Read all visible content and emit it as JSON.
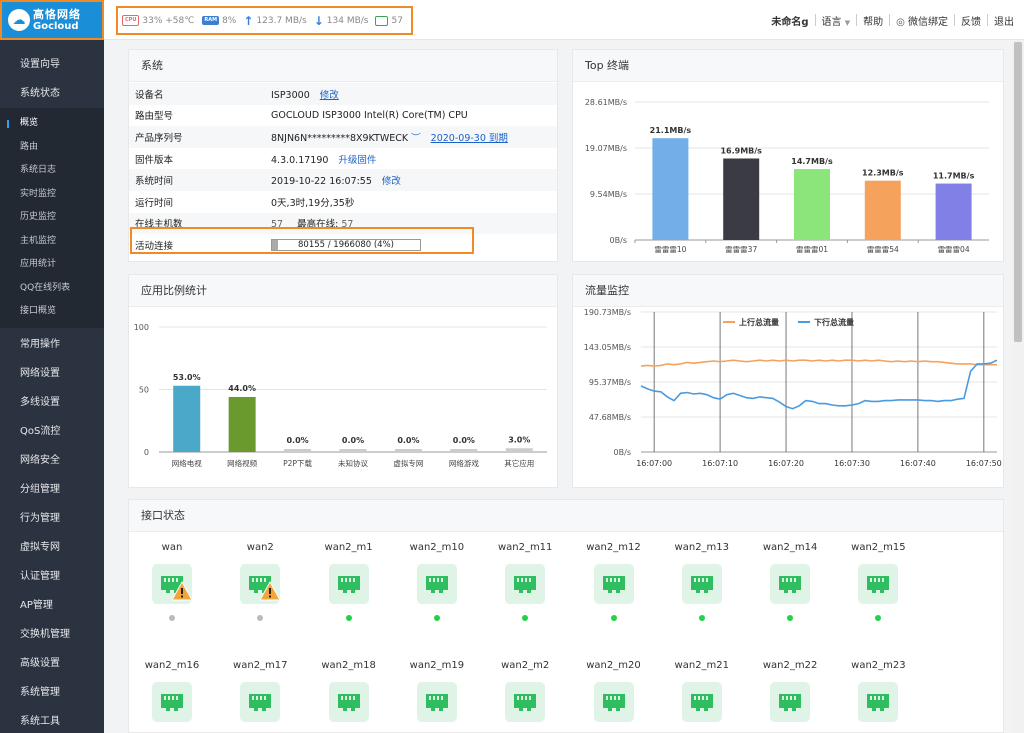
{
  "brand": {
    "name_cn": "高恪网络",
    "name_en": "Gocloud"
  },
  "status": {
    "cpu_icon": "CPU",
    "cpu": "33% +58℃",
    "ram_icon": "RAM",
    "ram": "8%",
    "up": "123.7 MB/s",
    "down": "134 MB/s",
    "hosts": "57"
  },
  "topnav": {
    "user": "未命名g",
    "lang": "语言",
    "help": "帮助",
    "wechat": "微信绑定",
    "feedback": "反馈",
    "logout": "退出"
  },
  "sidebar": {
    "main_before": [
      {
        "label": "设置向导"
      },
      {
        "label": "系统状态"
      }
    ],
    "sub": [
      {
        "label": "概览",
        "active": true
      },
      {
        "label": "路由"
      },
      {
        "label": "系统日志"
      },
      {
        "label": "实时监控"
      },
      {
        "label": "历史监控"
      },
      {
        "label": "主机监控"
      },
      {
        "label": "应用统计"
      },
      {
        "label": "QQ在线列表"
      },
      {
        "label": "接口概览"
      }
    ],
    "main_after": [
      {
        "label": "常用操作"
      },
      {
        "label": "网络设置"
      },
      {
        "label": "多线设置"
      },
      {
        "label": "QoS流控"
      },
      {
        "label": "网络安全"
      },
      {
        "label": "分组管理"
      },
      {
        "label": "行为管理"
      },
      {
        "label": "虚拟专网"
      },
      {
        "label": "认证管理"
      },
      {
        "label": "AP管理"
      },
      {
        "label": "交换机管理"
      },
      {
        "label": "高级设置"
      },
      {
        "label": "系统管理"
      },
      {
        "label": "系统工具"
      }
    ]
  },
  "system": {
    "title": "系统",
    "device_name": {
      "label": "设备名",
      "value": "ISP3000",
      "link": "修改"
    },
    "model": {
      "label": "路由型号",
      "value": "GOCLOUD ISP3000 Intel(R) Core(TM) CPU"
    },
    "serial": {
      "label": "产品序列号",
      "value": "8NJN6N*********8X9KTWECK",
      "link": "2020-09-30 到期"
    },
    "firmware": {
      "label": "固件版本",
      "value": "4.3.0.17190",
      "link": "升级固件"
    },
    "systime": {
      "label": "系统时间",
      "value": "2019-10-22 16:07:55",
      "link": "修改"
    },
    "uptime": {
      "label": "运行时间",
      "value": "0天,3时,19分,35秒"
    },
    "online": {
      "label": "在线主机数",
      "value": "57",
      "max_label": "最高在线:",
      "max_value": "57"
    },
    "conn": {
      "label": "活动连接",
      "text": "80155 / 1966080 (4%)",
      "percent": 4
    }
  },
  "top_terminals": {
    "title": "Top 终端",
    "chart_data": {
      "type": "bar",
      "categories": [
        "雷雷雷10",
        "雷雷雷37",
        "雷雷雷01",
        "雷雷雷54",
        "雷雷雷04"
      ],
      "values": [
        21.1,
        16.9,
        14.7,
        12.3,
        11.7
      ],
      "value_labels": [
        "21.1MB/s",
        "16.9MB/s",
        "14.7MB/s",
        "12.3MB/s",
        "11.7MB/s"
      ],
      "colors": [
        "#73aee8",
        "#3b3c43",
        "#8ce57a",
        "#f5a35c",
        "#8080e6"
      ],
      "ylim": [
        0,
        28.61
      ],
      "yticks": [
        0,
        9.54,
        19.07,
        28.61
      ],
      "ytick_labels": [
        "0B/s",
        "9.54MB/s",
        "19.07MB/s",
        "28.61MB/s"
      ],
      "grid": true
    }
  },
  "app_stats": {
    "title": "应用比例统计",
    "chart_data": {
      "type": "bar",
      "categories": [
        "网络电视",
        "网络视频",
        "P2P下载",
        "未知协议",
        "虚拟专网",
        "网络游戏",
        "其它应用"
      ],
      "values": [
        53.0,
        44.0,
        0.0,
        0.0,
        0.0,
        0.0,
        3.0
      ],
      "value_labels": [
        "53.0%",
        "44.0%",
        "0.0%",
        "0.0%",
        "0.0%",
        "0.0%",
        "3.0%"
      ],
      "colors": [
        "#4aa8c8",
        "#6a9a2e",
        "#cccccc",
        "#cccccc",
        "#cccccc",
        "#cccccc",
        "#cccccc"
      ],
      "ylim": [
        0,
        100
      ],
      "yticks": [
        0,
        50,
        100
      ],
      "ytick_labels": [
        "0",
        "50",
        "100"
      ],
      "grid": true
    }
  },
  "flow": {
    "title": "流量监控",
    "chart_data": {
      "type": "line",
      "x": [
        "16:06:58",
        "16:06:59",
        "16:07:00",
        "16:07:01",
        "16:07:02",
        "16:07:03",
        "16:07:04",
        "16:07:05",
        "16:07:06",
        "16:07:07",
        "16:07:08",
        "16:07:09",
        "16:07:10",
        "16:07:11",
        "16:07:12",
        "16:07:13",
        "16:07:14",
        "16:07:15",
        "16:07:16",
        "16:07:17",
        "16:07:18",
        "16:07:19",
        "16:07:20",
        "16:07:21",
        "16:07:22",
        "16:07:23",
        "16:07:24",
        "16:07:25",
        "16:07:26",
        "16:07:27",
        "16:07:28",
        "16:07:29",
        "16:07:30",
        "16:07:31",
        "16:07:32",
        "16:07:33",
        "16:07:34",
        "16:07:35",
        "16:07:36",
        "16:07:37",
        "16:07:38",
        "16:07:39",
        "16:07:40",
        "16:07:41",
        "16:07:42",
        "16:07:43",
        "16:07:44",
        "16:07:45",
        "16:07:46",
        "16:07:47",
        "16:07:48",
        "16:07:49",
        "16:07:50",
        "16:07:51",
        "16:07:52"
      ],
      "series": [
        {
          "name": "上行总流量",
          "color": "#f5a35c",
          "values": [
            117,
            118,
            117,
            118,
            120,
            119,
            120,
            122,
            121,
            122,
            123,
            124,
            123,
            124,
            125,
            124,
            123,
            124,
            125,
            124,
            125,
            124,
            125,
            124,
            125,
            125,
            124,
            125,
            124,
            125,
            124,
            125,
            125,
            124,
            125,
            124,
            125,
            124,
            123,
            124,
            123,
            124,
            123,
            124,
            123,
            123,
            122,
            121,
            120,
            120,
            120,
            119,
            119,
            119,
            119
          ]
        },
        {
          "name": "下行总流量",
          "color": "#4a9ae0",
          "values": [
            90,
            86,
            83,
            82,
            75,
            70,
            80,
            81,
            79,
            80,
            78,
            74,
            72,
            78,
            80,
            77,
            74,
            73,
            75,
            74,
            73,
            68,
            62,
            59,
            63,
            70,
            69,
            66,
            66,
            64,
            63,
            63,
            64,
            66,
            70,
            69,
            69,
            70,
            70,
            71,
            71,
            71,
            71,
            70,
            70,
            69,
            70,
            70,
            72,
            73,
            110,
            120,
            120,
            121,
            125,
            125,
            125,
            124,
            127,
            118
          ]
        }
      ],
      "ylim": [
        0,
        190.73
      ],
      "yticks": [
        0,
        47.68,
        95.37,
        143.05,
        190.73
      ],
      "ytick_labels": [
        "0B/s",
        "47.68MB/s",
        "95.37MB/s",
        "143.05MB/s",
        "190.73MB/s"
      ],
      "xtick_labels": [
        "16:07:00",
        "16:07:10",
        "16:07:20",
        "16:07:30",
        "16:07:40",
        "16:07:50"
      ],
      "legend_position": "top"
    }
  },
  "interfaces": {
    "title": "接口状态",
    "ports": [
      {
        "name": "wan",
        "warn": true,
        "online": false
      },
      {
        "name": "wan2",
        "warn": true,
        "online": false
      },
      {
        "name": "wan2_m1",
        "warn": false,
        "online": true
      },
      {
        "name": "wan2_m10",
        "warn": false,
        "online": true
      },
      {
        "name": "wan2_m11",
        "warn": false,
        "online": true
      },
      {
        "name": "wan2_m12",
        "warn": false,
        "online": true
      },
      {
        "name": "wan2_m13",
        "warn": false,
        "online": true
      },
      {
        "name": "wan2_m14",
        "warn": false,
        "online": true
      },
      {
        "name": "wan2_m15",
        "warn": false,
        "online": true
      },
      {
        "name": "wan2_m16",
        "warn": false,
        "online": true
      },
      {
        "name": "wan2_m17",
        "warn": false,
        "online": true
      },
      {
        "name": "wan2_m18",
        "warn": false,
        "online": true
      },
      {
        "name": "wan2_m19",
        "warn": false,
        "online": true
      },
      {
        "name": "wan2_m2",
        "warn": false,
        "online": true
      },
      {
        "name": "wan2_m20",
        "warn": false,
        "online": true
      },
      {
        "name": "wan2_m21",
        "warn": false,
        "online": true
      },
      {
        "name": "wan2_m22",
        "warn": false,
        "online": true
      },
      {
        "name": "wan2_m23",
        "warn": false,
        "online": true
      }
    ]
  },
  "colors": {
    "accent": "#1a8fd8",
    "highlight": "#f08a24",
    "link": "#1a62c8",
    "port_green": "#2fbe5f",
    "offline": "#bbbbbb"
  }
}
